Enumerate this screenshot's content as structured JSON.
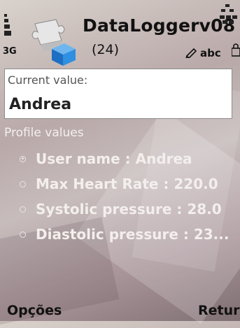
{
  "status": {
    "network_label": "3G",
    "input_mode": "abc"
  },
  "header": {
    "app_title": "DataLoggerv08",
    "count": "(24)"
  },
  "current": {
    "label": "Current value:",
    "value": "Andrea"
  },
  "profile": {
    "heading": "Profile values",
    "items": [
      {
        "label": "User name : Andrea",
        "selected": true
      },
      {
        "label": "Max Heart Rate : 220.0",
        "selected": false
      },
      {
        "label": "Systolic pressure : 28.0",
        "selected": false
      },
      {
        "label": "Diastolic pressure : 23...",
        "selected": false
      }
    ]
  },
  "softkeys": {
    "left": "Opções",
    "right": "Return"
  },
  "icons": {
    "app": "puzzle-cube-icon",
    "signal": "signal-strength-icon",
    "pen": "pen-input-icon",
    "corner": "network-transfer-icon",
    "lock": "lock-icon"
  }
}
